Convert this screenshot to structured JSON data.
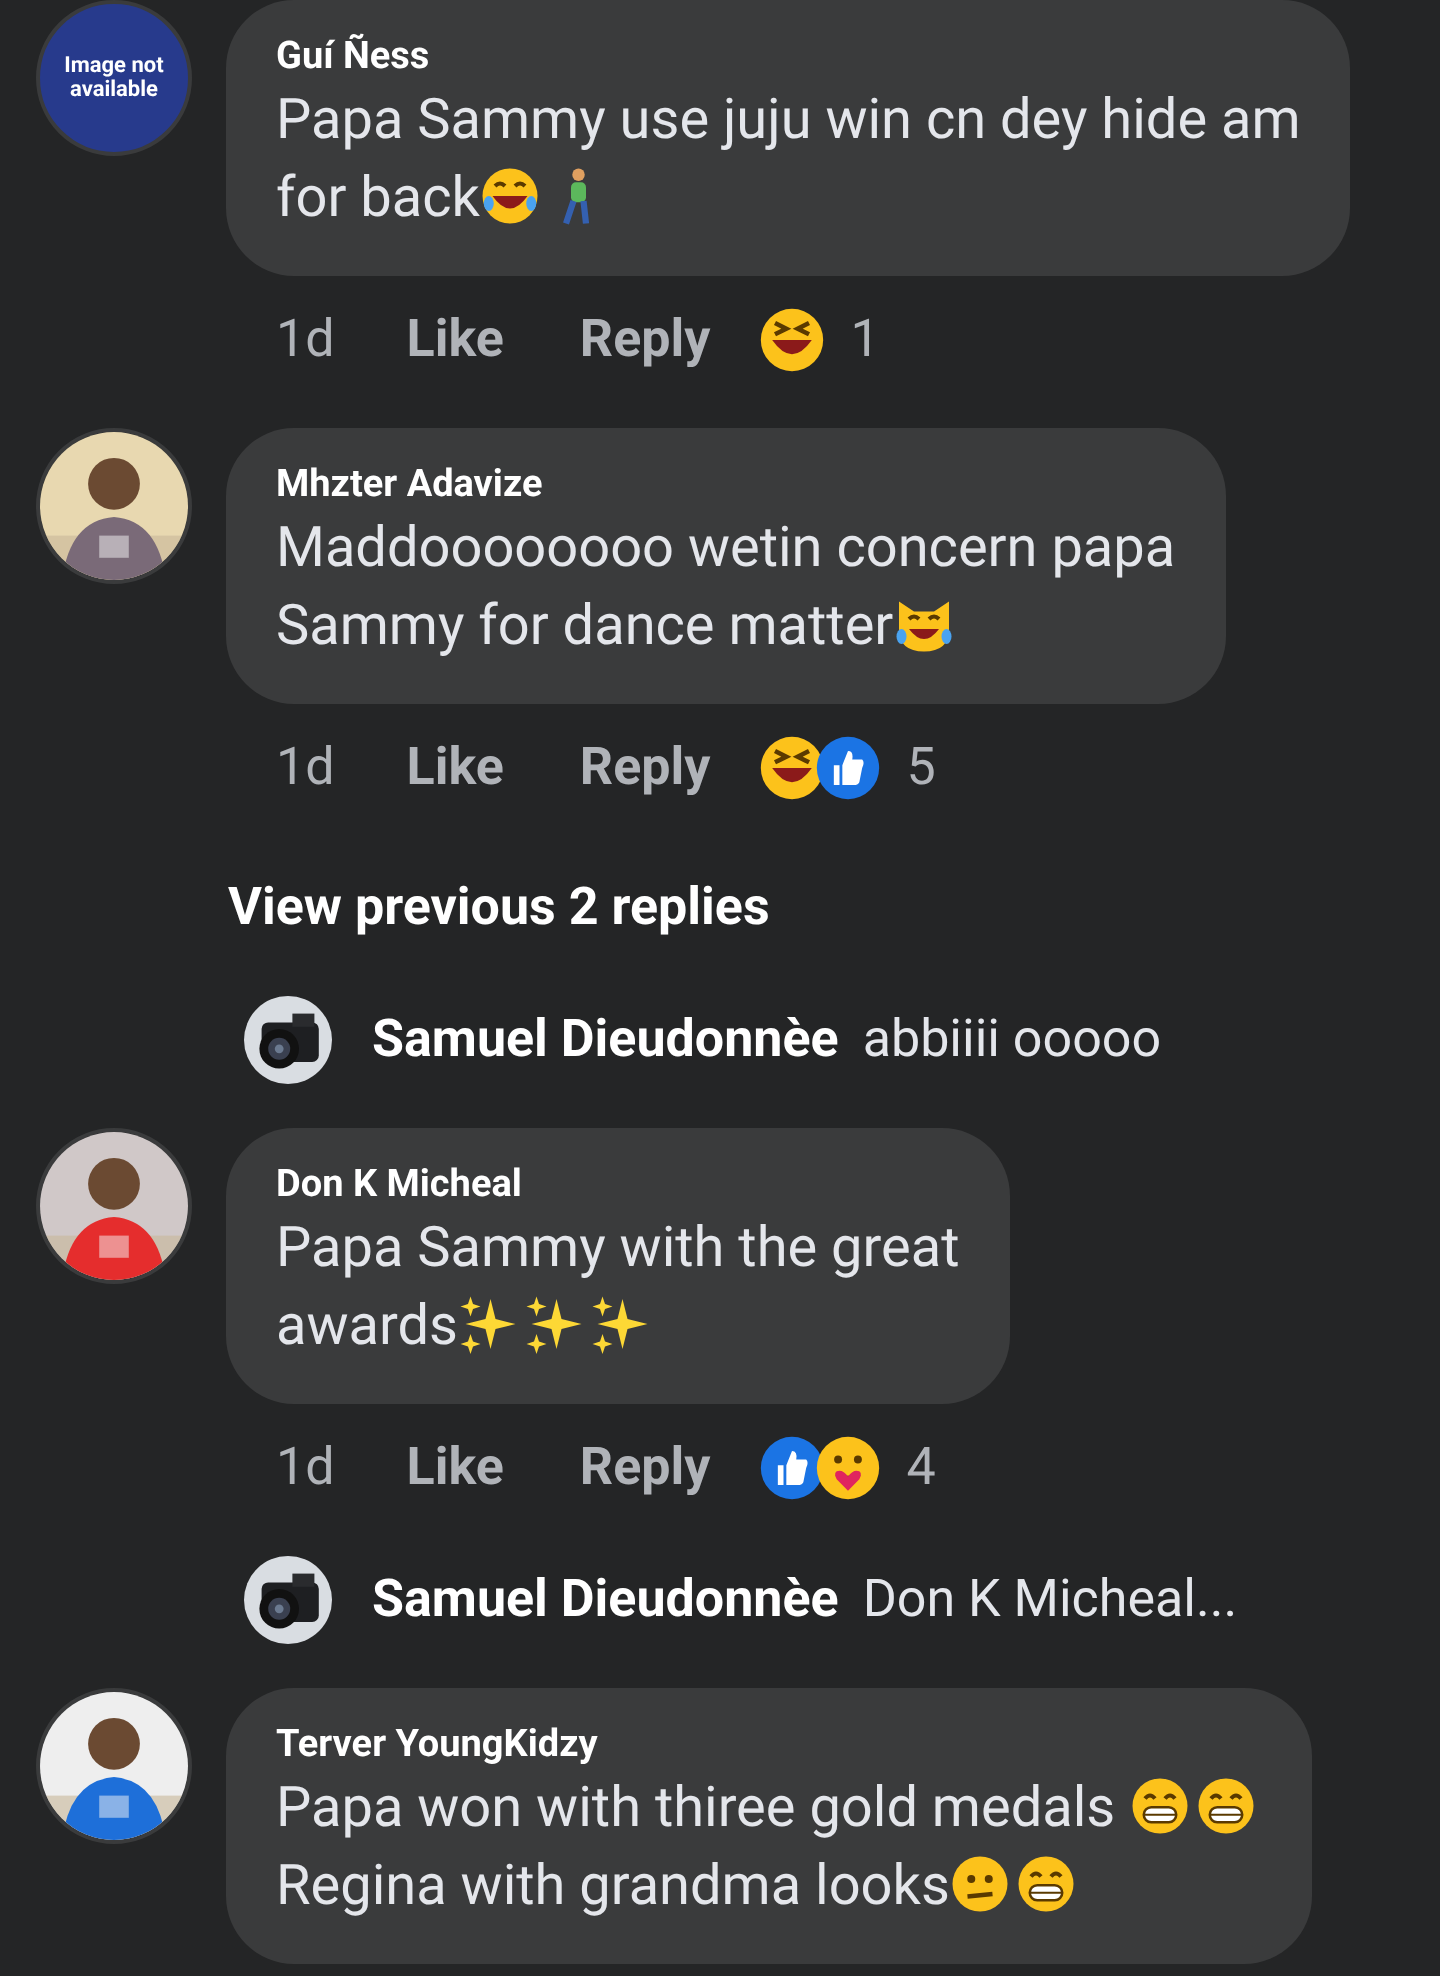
{
  "items": [
    {
      "kind": "comment",
      "avatar": {
        "kind": "placeholder",
        "text": "Image not available"
      },
      "author": "Guí Ñess",
      "lines": [
        [
          {
            "kind": "text",
            "value": "Papa Sammy use juju win cn dey hide am"
          }
        ],
        [
          {
            "kind": "text",
            "value": "for back"
          },
          {
            "kind": "tears_of_joy"
          },
          {
            "kind": "walking"
          }
        ]
      ],
      "time": "1d",
      "like": "Like",
      "reply": "Reply",
      "reactions": [
        {
          "kind": "haha"
        }
      ],
      "reaction_count": "1"
    },
    {
      "kind": "comment",
      "avatar": {
        "kind": "picture"
      },
      "author": "Mhzter Adavize",
      "lines": [
        [
          {
            "kind": "text",
            "value": "Maddoooooooo wetin concern papa"
          }
        ],
        [
          {
            "kind": "text",
            "value": "Sammy for dance matter"
          },
          {
            "kind": "cat_joy"
          }
        ]
      ],
      "time": "1d",
      "like": "Like",
      "reply": "Reply",
      "reactions": [
        {
          "kind": "haha"
        },
        {
          "kind": "like"
        }
      ],
      "reaction_count": "5"
    },
    {
      "kind": "view_more",
      "text": "View previous 2 replies"
    },
    {
      "kind": "reply_preview",
      "author": "Samuel Dieudonnèe",
      "text": "abbiiii ooooo"
    },
    {
      "kind": "comment",
      "avatar": {
        "kind": "picture"
      },
      "author": "Don K Micheal",
      "lines": [
        [
          {
            "kind": "text",
            "value": "Papa Sammy with the great"
          }
        ],
        [
          {
            "kind": "text",
            "value": "awards"
          },
          {
            "kind": "sparkles"
          },
          {
            "kind": "sparkles"
          },
          {
            "kind": "sparkles"
          }
        ]
      ],
      "time": "1d",
      "like": "Like",
      "reply": "Reply",
      "reactions": [
        {
          "kind": "like"
        },
        {
          "kind": "care"
        }
      ],
      "reaction_count": "4"
    },
    {
      "kind": "reply_preview",
      "author": "Samuel Dieudonnèe",
      "text": "Don K Micheal..."
    },
    {
      "kind": "comment",
      "avatar": {
        "kind": "picture"
      },
      "author": "Terver YoungKidzy",
      "lines": [
        [
          {
            "kind": "text",
            "value": "Papa won with thiree gold medals "
          },
          {
            "kind": "grin"
          },
          {
            "kind": "grin"
          }
        ],
        [
          {
            "kind": "text",
            "value": "Regina with grandma looks"
          },
          {
            "kind": "confused"
          },
          {
            "kind": "grin"
          }
        ]
      ]
    }
  ]
}
